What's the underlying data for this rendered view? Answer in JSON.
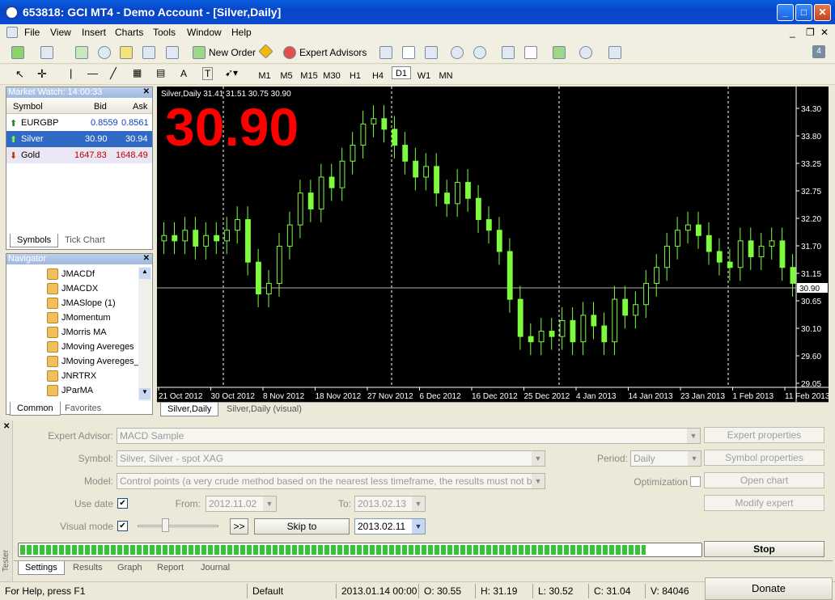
{
  "window": {
    "title": "653818: GCI MT4 - Demo Account - [Silver,Daily]",
    "min": "_",
    "max": "□",
    "close": "✕"
  },
  "menu": [
    "File",
    "View",
    "Insert",
    "Charts",
    "Tools",
    "Window",
    "Help"
  ],
  "toolbar": {
    "new_order": "New Order",
    "expert_advisors": "Expert Advisors",
    "timeframes": [
      "M1",
      "M5",
      "M15",
      "M30",
      "H1",
      "H4",
      "D1",
      "W1",
      "MN"
    ],
    "selected_timeframe": "D1",
    "text_tool": "A"
  },
  "market_watch": {
    "title": "Market Watch: 14:00:33",
    "headers": [
      "Symbol",
      "Bid",
      "Ask"
    ],
    "rows": [
      {
        "symbol": "EURGBP",
        "bid": "0.8559",
        "ask": "0.8561",
        "dir": "up"
      },
      {
        "symbol": "Silver",
        "bid": "30.90",
        "ask": "30.94",
        "dir": "up"
      },
      {
        "symbol": "Gold",
        "bid": "1647.83",
        "ask": "1648.49",
        "dir": "down"
      }
    ],
    "tabs": [
      "Symbols",
      "Tick Chart"
    ]
  },
  "navigator": {
    "title": "Navigator",
    "items": [
      "JMACDf",
      "JMACDX",
      "JMASlope (1)",
      "JMomentum",
      "JMorris MA",
      "JMoving Avereges",
      "JMoving Avereges_",
      "JNRTRX",
      "JParMA"
    ],
    "tabs": [
      "Common",
      "Favorites"
    ]
  },
  "chart": {
    "header": "Silver,Daily  31.41 31.51 30.75 30.90",
    "big_price": "30.90",
    "price_tag": "30.90",
    "y_ticks": [
      "34.30",
      "33.80",
      "33.25",
      "32.75",
      "32.20",
      "31.70",
      "31.15",
      "30.65",
      "30.10",
      "29.60",
      "29.05"
    ],
    "x_ticks": [
      "21 Oct 2012",
      "30 Oct 2012",
      "8 Nov 2012",
      "18 Nov 2012",
      "27 Nov 2012",
      "6 Dec 2012",
      "16 Dec 2012",
      "25 Dec 2012",
      "4 Jan 2013",
      "14 Jan 2013",
      "23 Jan 2013",
      "1 Feb 2013",
      "11 Feb 2013"
    ],
    "tabs": [
      "Silver,Daily",
      "Silver,Daily (visual)"
    ],
    "colors": {
      "bull": "#7cfc3c",
      "bear": "#7cfc3c",
      "bg": "#000000"
    }
  },
  "chart_data": {
    "type": "line",
    "title": "Silver,Daily",
    "ylim": [
      29.05,
      34.3
    ],
    "series": [
      {
        "name": "Silver,Daily",
        "values": [
          31.8,
          31.7,
          31.9,
          31.6,
          31.8,
          31.7,
          31.9,
          32.1,
          31.3,
          30.7,
          30.9,
          31.6,
          32.0,
          32.6,
          32.3,
          32.9,
          32.7,
          33.2,
          33.5,
          33.9,
          34.0,
          33.8,
          33.5,
          33.2,
          32.9,
          33.1,
          32.6,
          32.4,
          32.8,
          32.5,
          32.1,
          31.9,
          31.5,
          30.6,
          29.9,
          29.8,
          30.0,
          29.9,
          30.2,
          29.8,
          30.3,
          30.1,
          29.8,
          30.6,
          30.3,
          30.5,
          30.9,
          31.2,
          31.6,
          31.9,
          32.0,
          31.8,
          31.5,
          31.3,
          31.2,
          31.7,
          31.4,
          31.6,
          31.7,
          31.2,
          30.9
        ]
      }
    ]
  },
  "tester": {
    "expert_advisor_label": "Expert Advisor:",
    "expert_advisor": "MACD Sample",
    "symbol_label": "Symbol:",
    "symbol": "Silver, Silver - spot XAG",
    "model_label": "Model:",
    "model": "Control points (a very crude method based on the nearest less timeframe, the results must not be considered",
    "use_date_label": "Use date",
    "from_label": "From:",
    "from": "2012.11.02",
    "to_label": "To:",
    "to": "2013.02.13",
    "visual_mode_label": "Visual mode",
    "skip_btn": ">>",
    "skip_to": "Skip to",
    "skip_date": "2013.02.11",
    "period_label": "Period:",
    "period": "Daily",
    "optimization_label": "Optimization",
    "btn_expert_props": "Expert properties",
    "btn_symbol_props": "Symbol properties",
    "btn_open_chart": "Open chart",
    "btn_modify_expert": "Modify expert",
    "btn_stop": "Stop",
    "progress": 0.92,
    "tabs": [
      "Settings",
      "Results",
      "Graph",
      "Report",
      "Journal"
    ],
    "side_label": "Tester"
  },
  "status": {
    "help": "For Help, press F1",
    "profile": "Default",
    "time": "2013.01.14 00:00",
    "o": "O: 30.55",
    "h": "H: 31.19",
    "l": "L: 30.52",
    "c": "C: 31.04",
    "v": "V: 84046",
    "donate": "Donate"
  }
}
